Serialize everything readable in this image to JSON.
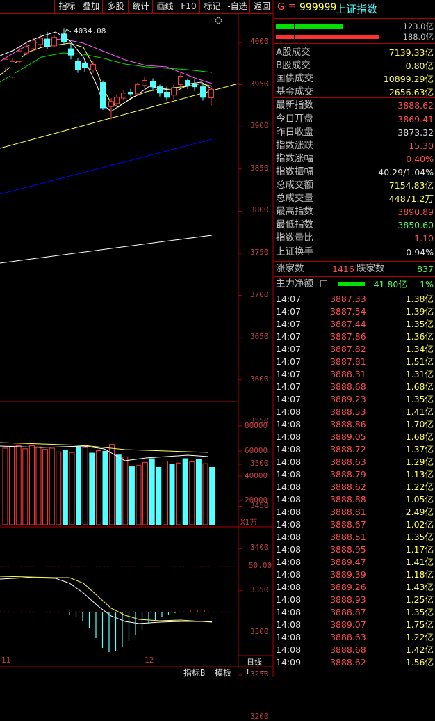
{
  "toolbar": {
    "buttons": [
      "指标",
      "叠加",
      "多股",
      "统计",
      "画线",
      "F10",
      "标记",
      "-自选",
      "返回"
    ]
  },
  "chart": {
    "max_label": "4034.08",
    "price_ticks": [
      "4000",
      "3950",
      "3900",
      "3850",
      "3800",
      "3750",
      "3700",
      "3650",
      "3600",
      "3550",
      "3500",
      "3450",
      "3400",
      "3350",
      "3300",
      "3250",
      "3200"
    ],
    "volume_ticks": [
      "80000",
      "60000",
      "40000",
      "20000"
    ],
    "volume_unit": "X1万",
    "macd_tick": "50.00",
    "date_labels": [
      "11",
      "12"
    ],
    "period_label": "日线",
    "bottom_tabs": [
      "指标B",
      "模板",
      "+",
      "−"
    ],
    "colors": {
      "up": "#ff3c3c",
      "down": "#54ffff",
      "ma5": "#ffffff",
      "ma10": "#ffff54",
      "ma20": "#ff54ff",
      "ma60": "#00e000",
      "trend": "#0000ff"
    }
  },
  "header": {
    "flag": "G",
    "menu_glyph": "≡",
    "code": "999999",
    "name": "上证指数"
  },
  "bars": {
    "buy_value": "123.0亿",
    "sell_value": "188.0亿"
  },
  "stats": [
    {
      "label": "A股成交",
      "value": "7139.33亿",
      "color": "#ffff54"
    },
    {
      "label": "B股成交",
      "value": "0.80亿",
      "color": "#ffff54"
    },
    {
      "label": "国债成交",
      "value": "10899.29亿",
      "color": "#ffff54"
    },
    {
      "label": "基金成交",
      "value": "2656.63亿",
      "color": "#ffff54"
    },
    {
      "label": "最新指数",
      "value": "3888.62",
      "color": "#ff5050"
    },
    {
      "label": "今日开盘",
      "value": "3869.41",
      "color": "#ff5050"
    },
    {
      "label": "昨日收盘",
      "value": "3873.32",
      "color": "#e0e0e0"
    },
    {
      "label": "指数涨跌",
      "value": "15.30",
      "color": "#ff5050"
    },
    {
      "label": "指数涨幅",
      "value": "0.40%",
      "color": "#ff5050"
    },
    {
      "label": "指数振幅",
      "value": "40.29/1.04%",
      "color": "#e0e0e0"
    },
    {
      "label": "总成交额",
      "value": "7154.83亿",
      "color": "#ffff54"
    },
    {
      "label": "总成交量",
      "value": "44871.2万",
      "color": "#ffff54"
    },
    {
      "label": "最高指数",
      "value": "3890.89",
      "color": "#ff5050"
    },
    {
      "label": "最低指数",
      "value": "3850.60",
      "color": "#54ff54"
    },
    {
      "label": "指数量比",
      "value": "1.10",
      "color": "#ff5050"
    },
    {
      "label": "上证换手",
      "value": "0.94%",
      "color": "#e0e0e0"
    }
  ],
  "breadth": {
    "up_label": "涨家数",
    "up_value": "1416",
    "down_label": "跌家数",
    "down_value": "837"
  },
  "mainforce": {
    "label": "主力净额",
    "value": "-41.80亿",
    "pct": "-1%"
  },
  "ticks": [
    {
      "time": "14:07",
      "price": "3887.33",
      "vol": "1.38亿"
    },
    {
      "time": "14:07",
      "price": "3887.54",
      "vol": "1.39亿"
    },
    {
      "time": "14:07",
      "price": "3887.44",
      "vol": "1.35亿"
    },
    {
      "time": "14:07",
      "price": "3887.86",
      "vol": "1.36亿"
    },
    {
      "time": "14:07",
      "price": "3887.82",
      "vol": "1.34亿"
    },
    {
      "time": "14:07",
      "price": "3887.81",
      "vol": "1.51亿"
    },
    {
      "time": "14:07",
      "price": "3888.31",
      "vol": "1.31亿"
    },
    {
      "time": "14:07",
      "price": "3888.68",
      "vol": "1.68亿"
    },
    {
      "time": "14:07",
      "price": "3889.23",
      "vol": "1.35亿"
    },
    {
      "time": "14:08",
      "price": "3888.53",
      "vol": "1.41亿"
    },
    {
      "time": "14:08",
      "price": "3888.86",
      "vol": "1.70亿"
    },
    {
      "time": "14:08",
      "price": "3889.05",
      "vol": "1.68亿"
    },
    {
      "time": "14:08",
      "price": "3888.72",
      "vol": "1.37亿"
    },
    {
      "time": "14:08",
      "price": "3888.63",
      "vol": "1.29亿"
    },
    {
      "time": "14:08",
      "price": "3888.79",
      "vol": "1.13亿"
    },
    {
      "time": "14:08",
      "price": "3888.62",
      "vol": "1.22亿"
    },
    {
      "time": "14:08",
      "price": "3888.88",
      "vol": "1.05亿"
    },
    {
      "time": "14:08",
      "price": "3888.81",
      "vol": "2.49亿"
    },
    {
      "time": "14:08",
      "price": "3888.67",
      "vol": "1.02亿"
    },
    {
      "time": "14:08",
      "price": "3888.51",
      "vol": "1.35亿"
    },
    {
      "time": "14:08",
      "price": "3888.95",
      "vol": "1.17亿"
    },
    {
      "time": "14:08",
      "price": "3889.47",
      "vol": "1.41亿"
    },
    {
      "time": "14:08",
      "price": "3889.39",
      "vol": "1.18亿"
    },
    {
      "time": "14:08",
      "price": "3889.26",
      "vol": "1.43亿"
    },
    {
      "time": "14:08",
      "price": "3888.93",
      "vol": "1.25亿"
    },
    {
      "time": "14:08",
      "price": "3888.87",
      "vol": "1.35亿"
    },
    {
      "time": "14:08",
      "price": "3889.07",
      "vol": "1.75亿"
    },
    {
      "time": "14:08",
      "price": "3888.63",
      "vol": "1.22亿"
    },
    {
      "time": "14:08",
      "price": "3888.68",
      "vol": "1.42亿"
    },
    {
      "time": "14:09",
      "price": "3888.62",
      "vol": "1.56亿"
    }
  ]
}
